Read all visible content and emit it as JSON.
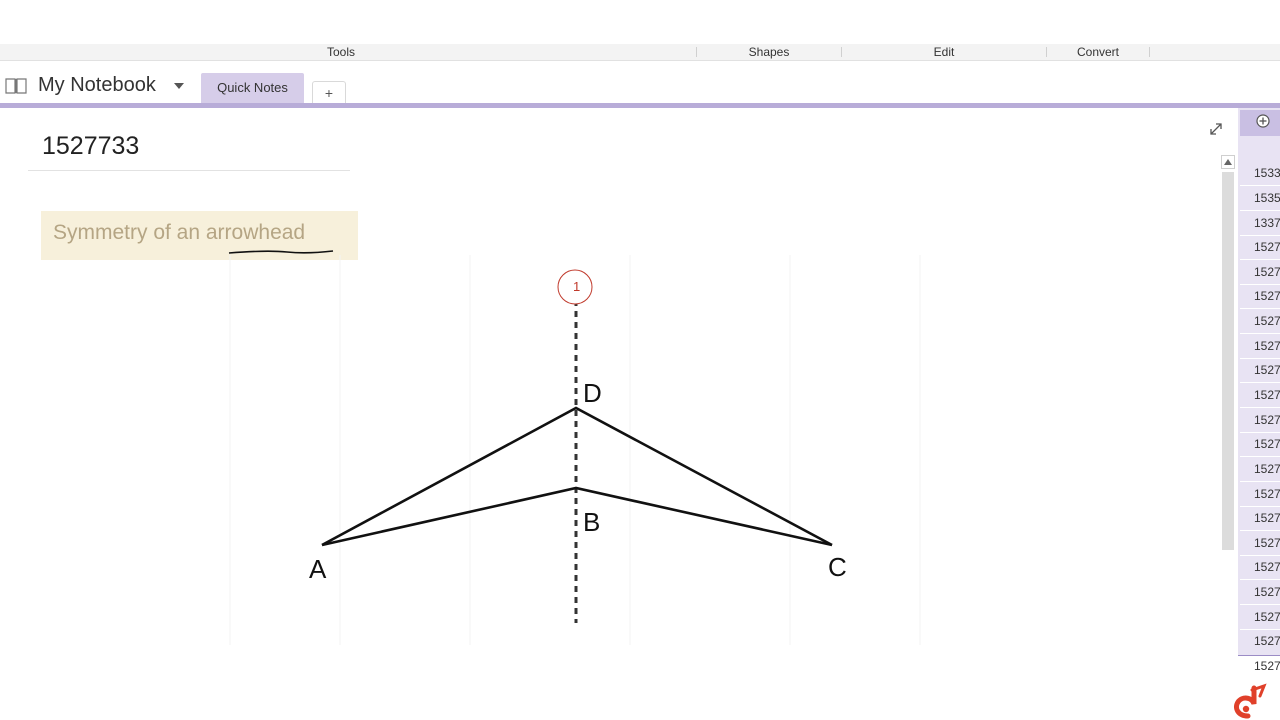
{
  "ribbon": {
    "groups": [
      "Tools",
      "Shapes",
      "Edit",
      "Convert"
    ]
  },
  "notebook": {
    "name": "My Notebook",
    "sections": [
      {
        "label": "Quick Notes",
        "active": true
      }
    ],
    "add_section_label": "+"
  },
  "page": {
    "title": "1527733",
    "note_text": "Symmetry of an arrowhead",
    "figure_labels": {
      "top_marker": "1",
      "d": "D",
      "b": "B",
      "a": "A",
      "c": "C"
    }
  },
  "page_list": [
    "1533",
    "1535",
    "1337",
    "1527",
    "1527",
    "1527",
    "1527",
    "1527",
    "1527",
    "1527",
    "1527",
    "1527",
    "1527",
    "1527",
    "1527",
    "1527",
    "1527",
    "1527",
    "1527",
    "1527",
    "1527"
  ],
  "colors": {
    "accent_purple": "#b8acd8",
    "tab_active": "#d6cde9",
    "note_highlight": "#f7f0db",
    "marker_red": "#c0392b",
    "logo_red": "#e0402a"
  }
}
